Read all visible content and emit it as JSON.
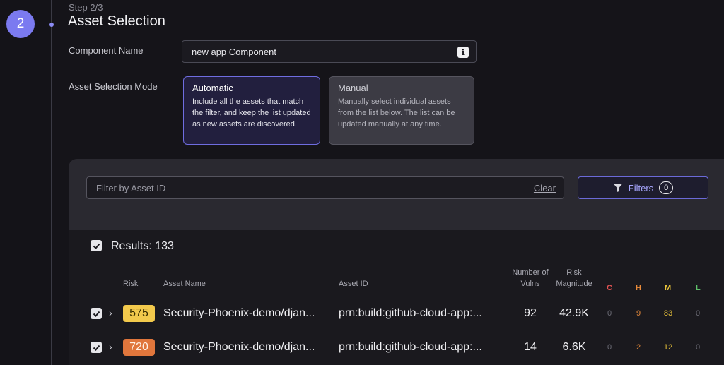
{
  "stepper": {
    "number": "2",
    "step_label": "Step 2/3",
    "title": "Asset Selection"
  },
  "component_name": {
    "label": "Component Name",
    "value": "new app Component",
    "info_icon": "i"
  },
  "mode": {
    "label": "Asset Selection Mode",
    "automatic": {
      "title": "Automatic",
      "description": "Include all the assets that match the filter, and keep the list updated as new assets are discovered."
    },
    "manual": {
      "title": "Manual",
      "description": "Manually select individual assets from the list below. The list can be updated manually at any time."
    },
    "selected": "Automatic"
  },
  "filter": {
    "placeholder": "Filter by Asset ID",
    "clear_label": "Clear",
    "filters_label": "Filters",
    "filters_count": "0"
  },
  "results": {
    "label": "Results: 133"
  },
  "table": {
    "headers": {
      "risk": "Risk",
      "asset_name": "Asset Name",
      "asset_id": "Asset ID",
      "vulns_line1": "Number of",
      "vulns_line2": "Vulns",
      "magnitude_line1": "Risk",
      "magnitude_line2": "Magnitude",
      "c": "C",
      "h": "H",
      "m": "M",
      "l": "L"
    },
    "rows": [
      {
        "risk": "575",
        "asset_name": "Security-Phoenix-demo/djan...",
        "asset_id": "prn:build:github-cloud-app:...",
        "vulns": "92",
        "magnitude": "42.9K",
        "c": "0",
        "h": "9",
        "m": "83",
        "l": "0"
      },
      {
        "risk": "720",
        "asset_name": "Security-Phoenix-demo/djan...",
        "asset_id": "prn:build:github-cloud-app:...",
        "vulns": "14",
        "magnitude": "6.6K",
        "c": "0",
        "h": "2",
        "m": "12",
        "l": "0"
      }
    ]
  },
  "colors": {
    "accent": "#7b7af0",
    "risk_575": "#f2c94c",
    "risk_720": "#e0763c",
    "critical": "#e05252",
    "high": "#e88a3a",
    "medium": "#e8c23a",
    "low": "#5fbf6a"
  }
}
